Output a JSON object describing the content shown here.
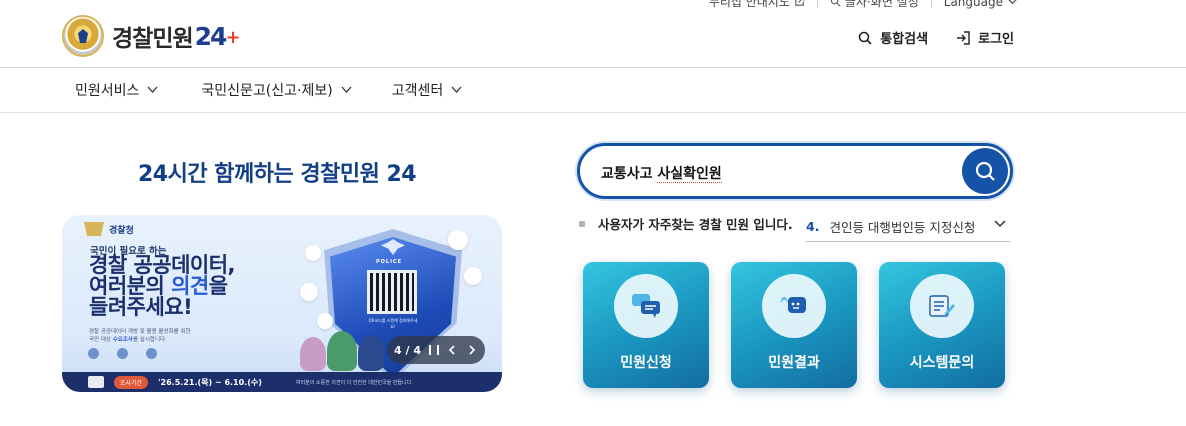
{
  "topbar": {
    "items": [
      {
        "label": "누리집 안내지도",
        "icon": "external-link-icon"
      },
      {
        "label": "글자·화면 설정",
        "icon": "magnifier-text-icon"
      },
      {
        "label": "Language",
        "icon": "chevron-down-icon"
      }
    ]
  },
  "logo": {
    "text": "경찰민원",
    "num": "24"
  },
  "util": {
    "search_label": "통합검색",
    "login_label": "로그인"
  },
  "nav": [
    {
      "label": "민원서비스"
    },
    {
      "label": "국민신문고(신고·제보)"
    },
    {
      "label": "고객센터"
    }
  ],
  "hero": {
    "title": "24시간 함께하는 경찰민원 24"
  },
  "banner": {
    "org": "경찰청",
    "subtitle": "국민이 필요로 하는",
    "heading_line1": "경찰 공공데이터,",
    "heading_line2_a": "여러분의 ",
    "heading_line2_b": "의견",
    "heading_line2_c": "을",
    "heading_line3": "들려주세요!",
    "note_line1": "경찰 공공데이터 개방 및 활용 활성화를 위한",
    "note_line2_a": "국민 대상 ",
    "note_line2_b": "수요조사",
    "note_line2_c": "를 실시합니다.",
    "period_tag": "조사기간",
    "period": "'26.5.21.(목) ~ 6.10.(수)",
    "footer_msg": "여러분의 소중한 의견이 더 안전한 대한민국을 만듭니다.",
    "shield_label": "POLICE",
    "qr_caption": "QR코드를 스캔해 참여해주세요!"
  },
  "carousel": {
    "page": "4 / 4"
  },
  "search": {
    "query_a": "교통사고 ",
    "query_b": "사실확인원"
  },
  "popular": {
    "label": "사용자가 자주찾는 경찰 민원 입니다.",
    "rank": "4.",
    "item": "견인등 대행법인등 지정신청"
  },
  "cards": [
    {
      "label": "민원신청",
      "icon": "chat-bubbles-icon"
    },
    {
      "label": "민원결과",
      "icon": "result-bubble-icon"
    },
    {
      "label": "시스템문의",
      "icon": "document-edit-icon"
    }
  ],
  "colors": {
    "primary": "#1553a8",
    "title": "#123e86",
    "card_top": "#34c6df",
    "card_bottom": "#126da0"
  }
}
